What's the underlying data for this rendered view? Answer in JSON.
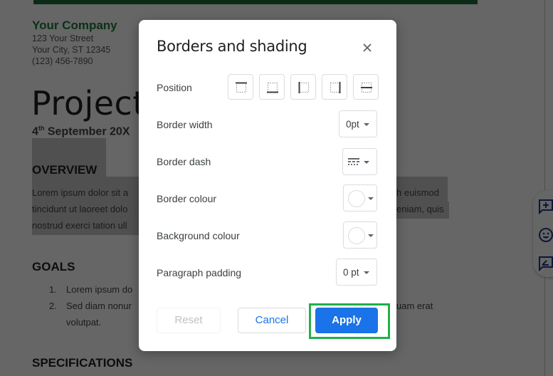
{
  "colors": {
    "brand_green": "#1e7a3a",
    "topbar_green": "#1e6b3a",
    "accent_blue": "#1a73e8",
    "side_icon_blue": "#1a3e8c",
    "highlight_green": "#21b04b"
  },
  "document": {
    "company_name": "Your Company",
    "address_lines": [
      "123 Your Street",
      "Your City, ST 12345",
      "(123) 456-7890"
    ],
    "title": "Project",
    "date_day": "4",
    "date_suffix": "th",
    "date_rest": " September 20X",
    "overview_heading": "OVERVIEW",
    "overview_left": [
      "Lorem ipsum dolor sit a",
      "tincidunt ut laoreet dolo",
      "nostrud exerci tation ull"
    ],
    "overview_right": [
      "h euismod",
      "eniam, quis"
    ],
    "goals_heading": "GOALS",
    "goals": [
      {
        "num": "1.",
        "text": "Lorem ipsum do"
      },
      {
        "num": "2.",
        "text": "Sed diam nonur"
      }
    ],
    "goal2_continuation": "volutpat.",
    "goal2_right": "uam erat",
    "specs_heading": "SPECIFICATIONS"
  },
  "side_tools": {
    "icons": [
      "add-comment-icon",
      "emoji-reaction-icon",
      "suggest-edit-icon"
    ]
  },
  "dialog": {
    "title": "Borders and shading",
    "close_icon": "close-icon",
    "position_label": "Position",
    "position_options": [
      "top-border",
      "bottom-border",
      "left-border",
      "right-border",
      "between-border"
    ],
    "border_width_label": "Border width",
    "border_width_value": "0pt",
    "border_dash_label": "Border dash",
    "border_dash_icon": "dash-style-icon",
    "border_colour_label": "Border colour",
    "border_colour_value": "#ffffff",
    "background_colour_label": "Background colour",
    "background_colour_value": "#ffffff",
    "paragraph_padding_label": "Paragraph padding",
    "paragraph_padding_value": "0 pt",
    "reset_label": "Reset",
    "cancel_label": "Cancel",
    "apply_label": "Apply"
  }
}
